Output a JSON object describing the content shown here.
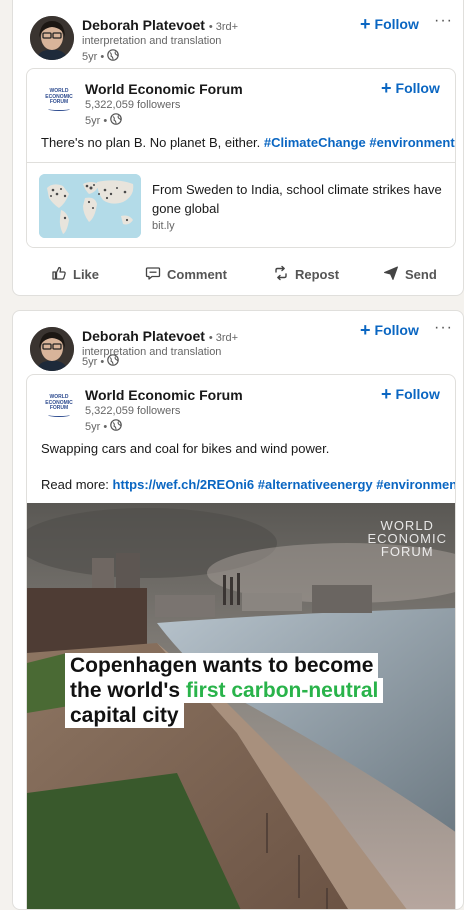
{
  "post1": {
    "author": {
      "name": "Deborah Platevoet",
      "degree": "• 3rd+",
      "headline": "interpretation and translation",
      "time": "5yr •"
    },
    "follow_label": "Follow",
    "more_label": "···",
    "shared": {
      "org_name": "World Economic Forum",
      "followers": "5,322,059 followers",
      "time": "5yr •",
      "follow_label": "Follow",
      "logo_text": [
        "WORLD",
        "ECONOMIC",
        "FORUM"
      ],
      "text": "There's no plan B. No planet B, either.",
      "hashtags": [
        "#ClimateChange",
        "#environment"
      ],
      "link_preview": {
        "title": "From Sweden to India, school climate strikes have gone global",
        "domain": "bit.ly"
      }
    },
    "actions": {
      "like": "Like",
      "comment": "Comment",
      "repost": "Repost",
      "send": "Send"
    }
  },
  "post2": {
    "author": {
      "name": "Deborah Platevoet",
      "degree": "• 3rd+",
      "headline": "interpretation and translation",
      "time": "5yr •"
    },
    "follow_label": "Follow",
    "more_label": "···",
    "shared": {
      "org_name": "World Economic Forum",
      "followers": "5,322,059 followers",
      "time": "5yr •",
      "follow_label": "Follow",
      "logo_text": [
        "WORLD",
        "ECONOMIC",
        "FORUM"
      ],
      "text_line1": "Swapping cars and coal for bikes and wind power.",
      "read_more_label": "Read more:",
      "link": "https://wef.ch/2REOni6",
      "hashtags": [
        "#alternativeenergy",
        "#environment"
      ],
      "video": {
        "logo_text": [
          "WORLD",
          "ECONOMIC",
          "FORUM"
        ],
        "caption_line1": "Copenhagen wants to become",
        "caption_line2_prefix": "the world's ",
        "caption_line2_highlight": "first carbon-neutral",
        "caption_line3": "capital city"
      }
    }
  },
  "colors": {
    "link": "#0a66c2",
    "highlight": "#29b34a"
  }
}
